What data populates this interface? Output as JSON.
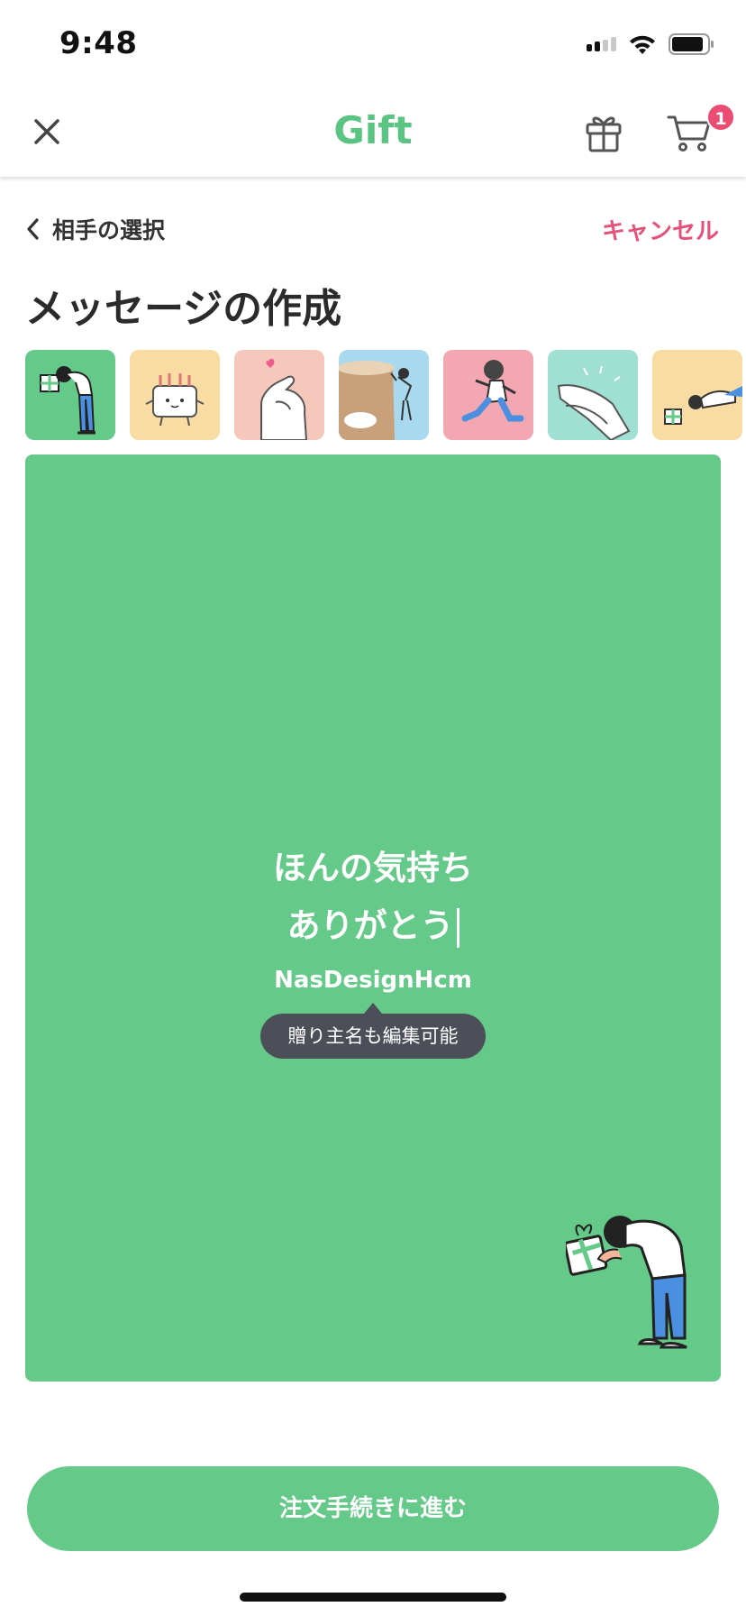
{
  "status_bar": {
    "time": "9:48"
  },
  "nav": {
    "title": "Gift",
    "cart_badge": "1",
    "brand_color": "#5ac483",
    "badge_color": "#ea4c73"
  },
  "subheader": {
    "back_label": "相手の選択",
    "cancel_label": "キャンセル",
    "cancel_color": "#e55279"
  },
  "page": {
    "title": "メッセージの作成"
  },
  "templates": [
    {
      "name": "bowing-person-gift",
      "bg": "#65c98a",
      "selected": true
    },
    {
      "name": "birthday-cake",
      "bg": "#f8dca4",
      "selected": false
    },
    {
      "name": "finger-heart",
      "bg": "#f5c8bb",
      "selected": false
    },
    {
      "name": "cliff-arigatou",
      "bg": "#a9d9ef",
      "selected": false
    },
    {
      "name": "running-person",
      "bg": "#f2a7b2",
      "selected": false
    },
    {
      "name": "clapping-hands",
      "bg": "#9fe0d3",
      "selected": false
    },
    {
      "name": "bowing-gift-low",
      "bg": "#f8dca4",
      "selected": false
    }
  ],
  "card": {
    "background": "#65c98a",
    "message_line1": "ほんの気持ち",
    "message_line2": "ありがとう",
    "sender_name": "NasDesignHcm",
    "tooltip": "贈り主名も編集可能"
  },
  "footer": {
    "order_button": "注文手続きに進む"
  }
}
